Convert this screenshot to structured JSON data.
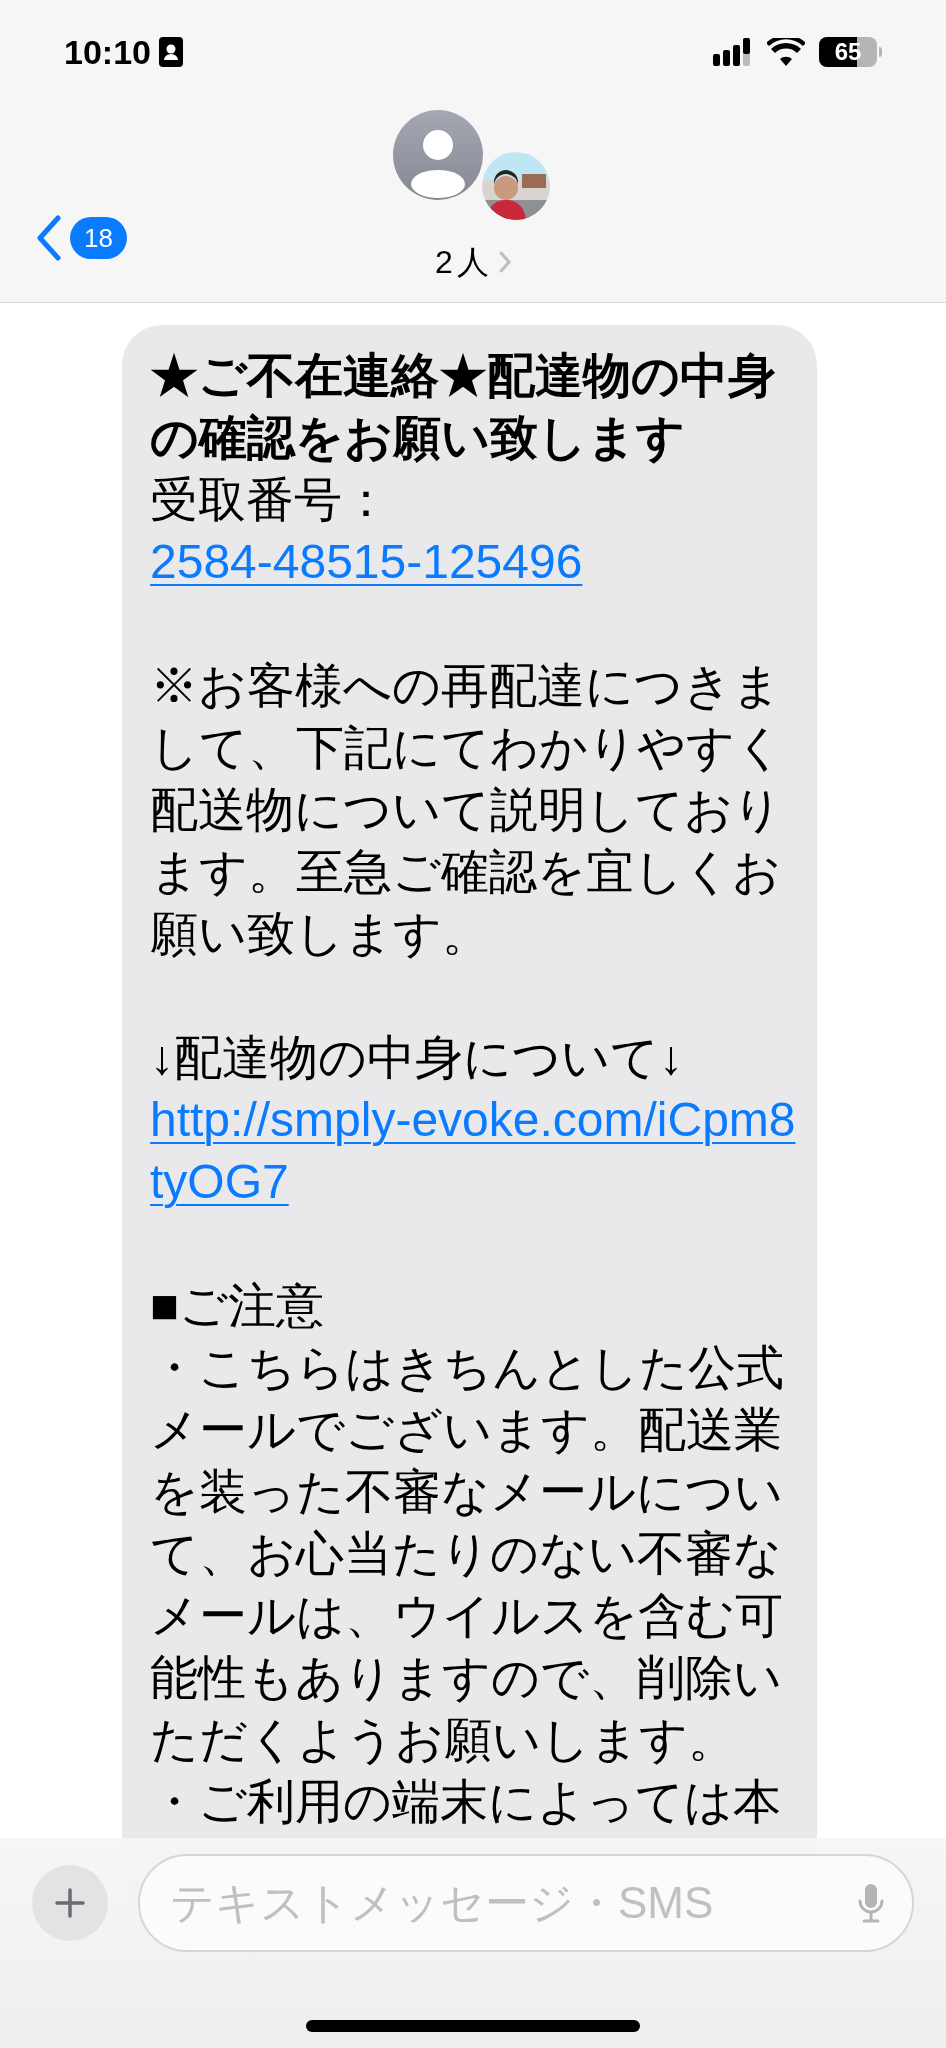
{
  "status_bar": {
    "time": "10:10",
    "battery": "65"
  },
  "nav": {
    "back_count": "18",
    "title": "2人"
  },
  "message": {
    "paragraphs": [
      {
        "kind": "bold",
        "text": "★ご不在連絡★配達物の中身の確認をお願い致します"
      },
      {
        "kind": "text",
        "text": "受取番号："
      },
      {
        "kind": "link",
        "text": "2584-48515-125496"
      },
      {
        "kind": "blank"
      },
      {
        "kind": "text",
        "text": "※お客様への再配達につきまして、下記にてわかりやすく配送物について説明しております。至急ご確認を宜しくお願い致します。"
      },
      {
        "kind": "blank"
      },
      {
        "kind": "text",
        "text": "↓配達物の中身について↓"
      },
      {
        "kind": "link",
        "text": "http://smply-evoke.com/iCpm8tyOG7"
      },
      {
        "kind": "blank"
      },
      {
        "kind": "text",
        "text": "■ご注意"
      },
      {
        "kind": "text",
        "text": "・こちらはきちんとした公式メールでございます。配送業を装った不審なメールについて、お心当たりのない不審なメールは、ウイルスを含む可能性もありますので、削除いただくようお願いします。"
      },
      {
        "kind": "text",
        "text": "・ご利用の端末によっては本"
      }
    ]
  },
  "composer": {
    "placeholder": "テキストメッセージ・SMS"
  }
}
